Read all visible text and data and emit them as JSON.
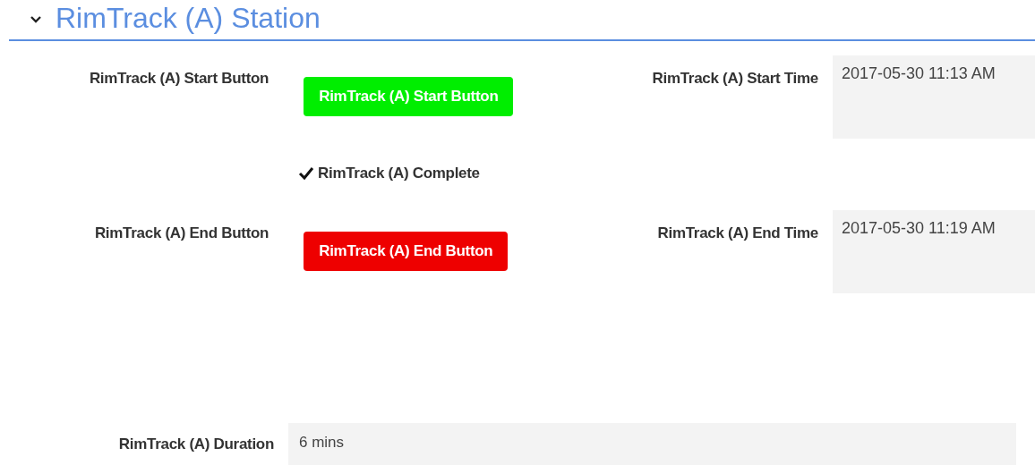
{
  "section": {
    "title": "RimTrack (A) Station",
    "expanded": true
  },
  "rows": [
    {
      "label": "RimTrack (A) Start Button",
      "button": {
        "label": "RimTrack (A) Start Button",
        "kind": "start"
      },
      "time_label": "RimTrack (A) Start Time",
      "time_value": "2017-05-30 11:13 AM"
    },
    {
      "label": "RimTrack (A) End Button",
      "button": {
        "label": "RimTrack (A) End Button",
        "kind": "end"
      },
      "time_label": "RimTrack (A) End Time",
      "time_value": "2017-05-30 11:19 AM"
    }
  ],
  "complete": {
    "label": "RimTrack (A) Complete",
    "checked": true
  },
  "duration": {
    "label": "RimTrack (A) Duration",
    "value": "6 mins"
  }
}
